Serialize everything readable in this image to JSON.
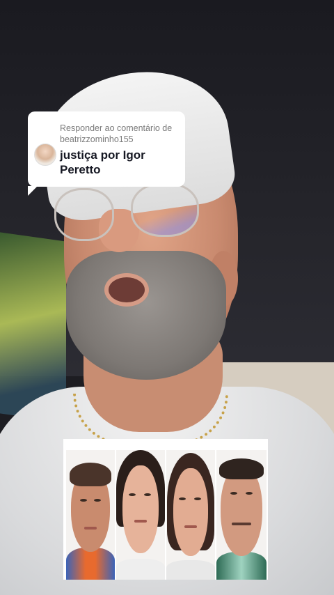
{
  "reply": {
    "header": "Responder ao comentário de beatrizzominho155",
    "comment": "justiça por Igor Peretto"
  },
  "collage": {
    "photos": [
      {
        "name": "suspect-1"
      },
      {
        "name": "suspect-2"
      },
      {
        "name": "suspect-3"
      },
      {
        "name": "suspect-4"
      }
    ]
  },
  "colors": {
    "bubble_bg": "#ffffff",
    "header_text": "#7a7a7a",
    "comment_text": "#161823"
  }
}
